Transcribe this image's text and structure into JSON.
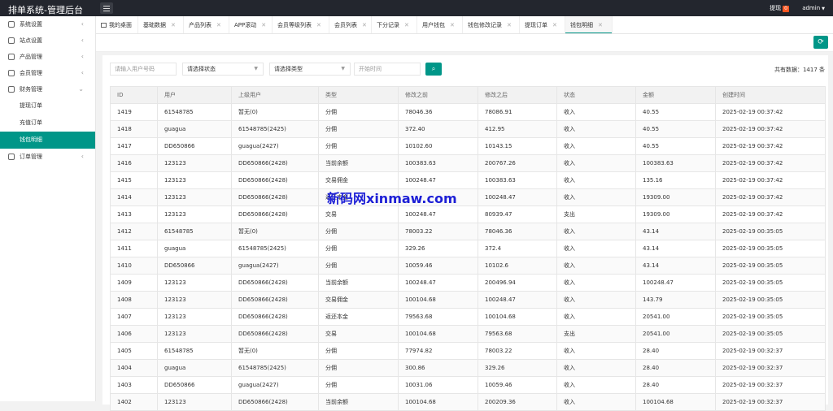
{
  "header": {
    "brand": "排单系统-管理后台",
    "withdraw_label": "提现",
    "withdraw_count": "0",
    "user": "admin"
  },
  "sidebar": {
    "items": [
      {
        "label": "系统设置",
        "icon": "gear-icon"
      },
      {
        "label": "站点设置",
        "icon": "cloud-icon"
      },
      {
        "label": "产品管理",
        "icon": "box-icon"
      },
      {
        "label": "会员管理",
        "icon": "user-icon"
      },
      {
        "label": "财务管理",
        "icon": "wallet-icon"
      }
    ],
    "subitems": [
      "提现订单",
      "充值订单",
      "钱包明细"
    ],
    "last": {
      "label": "订单管理",
      "icon": "order-icon"
    }
  },
  "tabs": [
    "我的桌面",
    "基础数据",
    "产品列表",
    "APP滚动",
    "会员等级列表",
    "会员列表",
    "下分记录",
    "用户钱包",
    "钱包修改记录",
    "提现订单",
    "钱包明细"
  ],
  "filters": {
    "user_placeholder": "请输入用户号码",
    "status_select": "请选择状态",
    "type_select": "请选择类型",
    "time_placeholder": "开始时间"
  },
  "total_text": "共有数据：1417 条",
  "table": {
    "columns": [
      "ID",
      "用户",
      "上级用户",
      "类型",
      "修改之前",
      "修改之后",
      "状态",
      "金额",
      "创建时间"
    ],
    "rows": [
      [
        "1419",
        "61548785",
        "暂无(0)",
        "分佣",
        "78046.36",
        "78086.91",
        "收入",
        "40.55",
        "2025-02-19 00:37:42"
      ],
      [
        "1418",
        "guagua",
        "61548785(2425)",
        "分佣",
        "372.40",
        "412.95",
        "收入",
        "40.55",
        "2025-02-19 00:37:42"
      ],
      [
        "1417",
        "DD650866",
        "guagua(2427)",
        "分佣",
        "10102.60",
        "10143.15",
        "收入",
        "40.55",
        "2025-02-19 00:37:42"
      ],
      [
        "1416",
        "123123",
        "DD650866(2428)",
        "当前余额",
        "100383.63",
        "200767.26",
        "收入",
        "100383.63",
        "2025-02-19 00:37:42"
      ],
      [
        "1415",
        "123123",
        "DD650866(2428)",
        "交易佣金",
        "100248.47",
        "100383.63",
        "收入",
        "135.16",
        "2025-02-19 00:37:42"
      ],
      [
        "1414",
        "123123",
        "DD650866(2428)",
        "返还本金",
        "",
        "100248.47",
        "收入",
        "19309.00",
        "2025-02-19 00:37:42"
      ],
      [
        "1413",
        "123123",
        "DD650866(2428)",
        "交易",
        "100248.47",
        "80939.47",
        "支出",
        "19309.00",
        "2025-02-19 00:37:42"
      ],
      [
        "1412",
        "61548785",
        "暂无(0)",
        "分佣",
        "78003.22",
        "78046.36",
        "收入",
        "43.14",
        "2025-02-19 00:35:05"
      ],
      [
        "1411",
        "guagua",
        "61548785(2425)",
        "分佣",
        "329.26",
        "372.4",
        "收入",
        "43.14",
        "2025-02-19 00:35:05"
      ],
      [
        "1410",
        "DD650866",
        "guagua(2427)",
        "分佣",
        "10059.46",
        "10102.6",
        "收入",
        "43.14",
        "2025-02-19 00:35:05"
      ],
      [
        "1409",
        "123123",
        "DD650866(2428)",
        "当前余额",
        "100248.47",
        "200496.94",
        "收入",
        "100248.47",
        "2025-02-19 00:35:05"
      ],
      [
        "1408",
        "123123",
        "DD650866(2428)",
        "交易佣金",
        "100104.68",
        "100248.47",
        "收入",
        "143.79",
        "2025-02-19 00:35:05"
      ],
      [
        "1407",
        "123123",
        "DD650866(2428)",
        "返还本金",
        "79563.68",
        "100104.68",
        "收入",
        "20541.00",
        "2025-02-19 00:35:05"
      ],
      [
        "1406",
        "123123",
        "DD650866(2428)",
        "交易",
        "100104.68",
        "79563.68",
        "支出",
        "20541.00",
        "2025-02-19 00:35:05"
      ],
      [
        "1405",
        "61548785",
        "暂无(0)",
        "分佣",
        "77974.82",
        "78003.22",
        "收入",
        "28.40",
        "2025-02-19 00:32:37"
      ],
      [
        "1404",
        "guagua",
        "61548785(2425)",
        "分佣",
        "300.86",
        "329.26",
        "收入",
        "28.40",
        "2025-02-19 00:32:37"
      ],
      [
        "1403",
        "DD650866",
        "guagua(2427)",
        "分佣",
        "10031.06",
        "10059.46",
        "收入",
        "28.40",
        "2025-02-19 00:32:37"
      ],
      [
        "1402",
        "123123",
        "DD650866(2428)",
        "当前余额",
        "100104.68",
        "200209.36",
        "收入",
        "100104.68",
        "2025-02-19 00:32:37"
      ]
    ]
  },
  "watermark": "新码网xinmaw.com"
}
